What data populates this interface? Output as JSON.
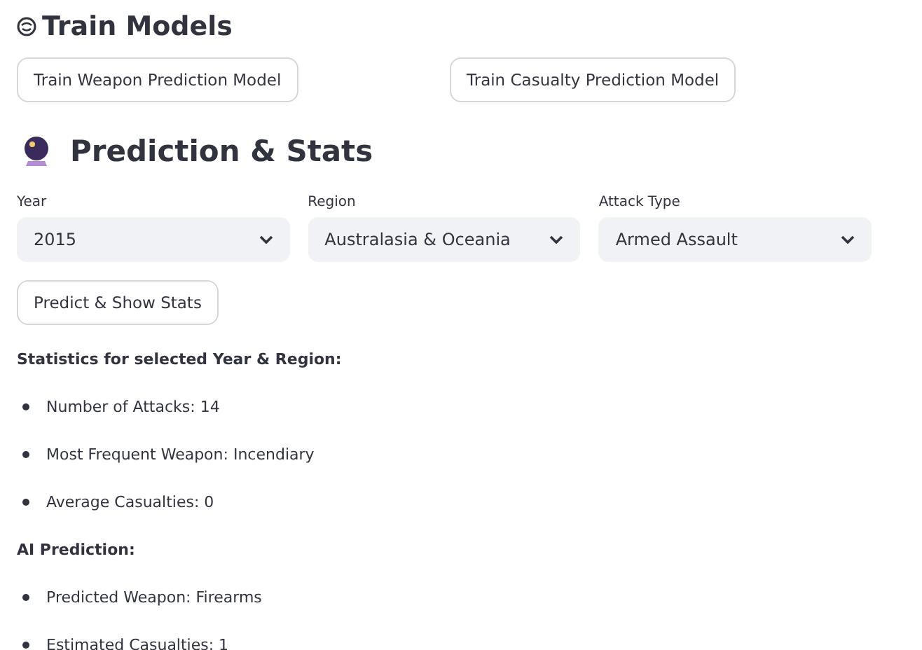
{
  "train_section": {
    "title": "Train Models",
    "buttons": [
      "Train Weapon Prediction Model",
      "Train Casualty Prediction Model"
    ]
  },
  "prediction_section": {
    "title": "Prediction & Stats",
    "selects": [
      {
        "label": "Year",
        "value": "2015"
      },
      {
        "label": "Region",
        "value": "Australasia & Oceania"
      },
      {
        "label": "Attack Type",
        "value": "Armed Assault"
      }
    ],
    "button": "Predict & Show Stats",
    "groups": [
      {
        "heading": "Statistics for selected Year & Region:",
        "items": [
          "Number of Attacks: 14",
          "Most Frequent Weapon: Incendiary",
          "Average Casualties: 0"
        ]
      },
      {
        "heading": "AI Prediction:",
        "items": [
          "Predicted Weapon: Firearms",
          "Estimated Casualties: 1"
        ]
      }
    ]
  }
}
